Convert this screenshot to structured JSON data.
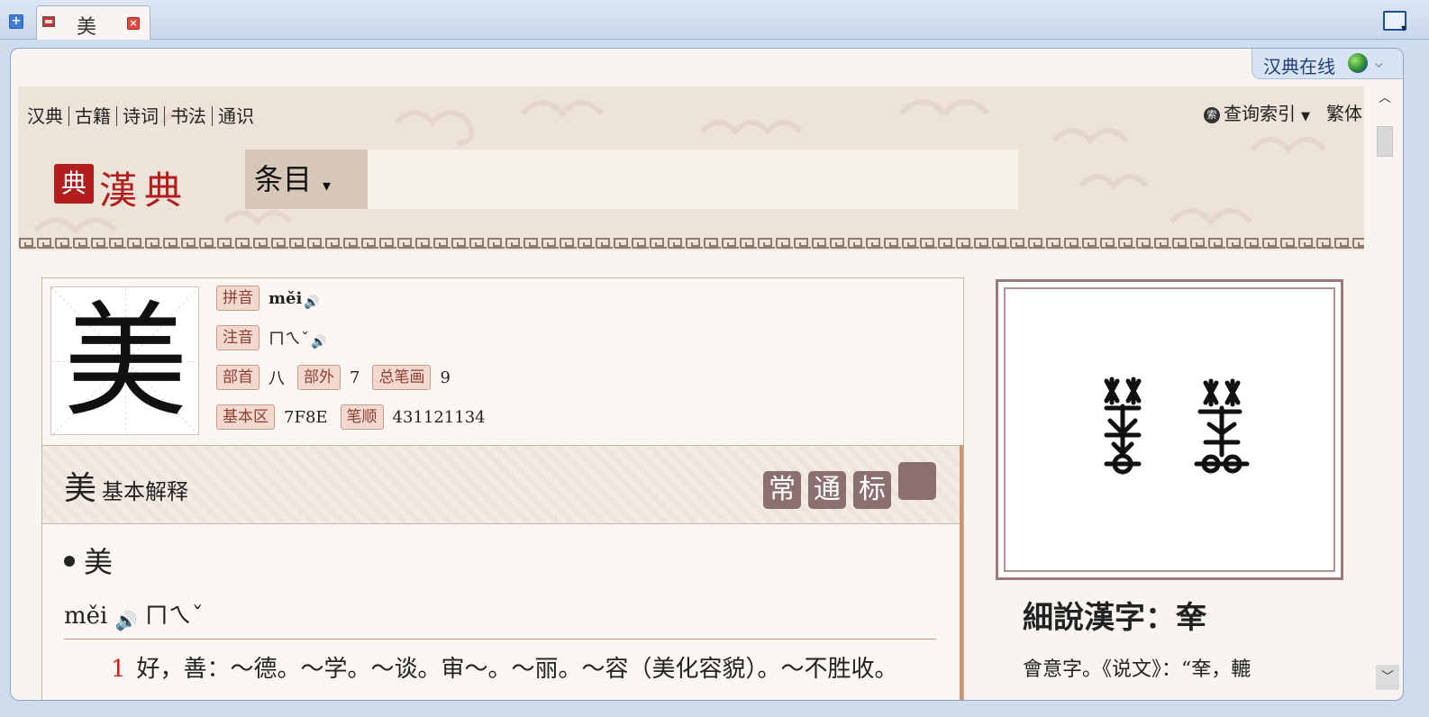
{
  "tab": {
    "title": "美"
  },
  "site_flag": {
    "name": "汉典在线"
  },
  "nav": {
    "items": [
      "汉典",
      "古籍",
      "诗词",
      "书法",
      "通识"
    ],
    "query_index": "查询索引",
    "traditional": "繁体"
  },
  "logo": {
    "seal": "典",
    "text": "漢典"
  },
  "search": {
    "scope": "条目",
    "value": ""
  },
  "character": {
    "glyph": "美",
    "pinyin_label": "拼音",
    "pinyin": "měi",
    "zhuyin_label": "注音",
    "zhuyin": "ㄇㄟˇ",
    "radical_label": "部首",
    "radical": "八",
    "outer_label": "部外",
    "outer": "7",
    "strokes_label": "总笔画",
    "strokes": "9",
    "block_label": "基本区",
    "block": "7F8E",
    "order_label": "笔顺",
    "order": "431121134"
  },
  "basic": {
    "char": "美",
    "title": "基本解释",
    "badges": [
      "常",
      "通",
      "标"
    ]
  },
  "definition": {
    "word": "美",
    "pinyin": "měi",
    "zhuyin": "ㄇㄟˇ",
    "items": [
      {
        "num": "1",
        "text": "好，善：～德。～学。～谈。审～。～丽。～容（美化容貌）。～不胜收。"
      }
    ]
  },
  "detail": {
    "title": "細說漢字：羍",
    "text": "會意字。《说文》：“羍，轆"
  },
  "colors": {
    "accent": "#b21d1d",
    "tag_bg": "#f2d8cf",
    "badge": "#8c7070"
  }
}
